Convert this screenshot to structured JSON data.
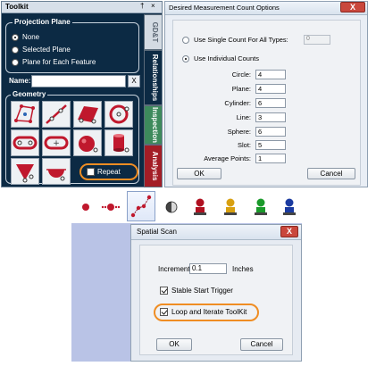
{
  "toolkit": {
    "title": "Toolkit",
    "pin": "†",
    "close": "×",
    "projection_plane": {
      "title": "Projection Plane",
      "options": [
        {
          "label": "None",
          "selected": true
        },
        {
          "label": "Selected Plane",
          "selected": false
        },
        {
          "label": "Plane for Each Feature",
          "selected": false
        }
      ]
    },
    "name_label": "Name:",
    "name_value": "",
    "name_clear": "X",
    "geometry": {
      "title": "Geometry",
      "tools": [
        "point-cloud-icon",
        "line-icon",
        "plane-icon",
        "circle-icon",
        "slot-icon",
        "round-slot-icon",
        "sphere-icon",
        "cylinder-icon",
        "cone-icon",
        "sphere-alt-icon"
      ]
    },
    "repeat_label": "Repeat",
    "repeat_checked": false,
    "tabs": [
      "GD&T",
      "Relationships",
      "Inspection",
      "Analysis"
    ],
    "colors": {
      "background": "#0c2a44",
      "highlight": "#ef8d23"
    }
  },
  "count_options": {
    "title": "Desired Measurement Count Options",
    "close": "X",
    "single_count_label": "Use Single Count For All Types:",
    "single_count_value": "0",
    "individual_counts_label": "Use Individual Counts",
    "individual_selected": true,
    "counts": [
      {
        "label": "Circle:",
        "value": "4"
      },
      {
        "label": "Plane:",
        "value": "4"
      },
      {
        "label": "Cylinder:",
        "value": "6"
      },
      {
        "label": "Line:",
        "value": "3"
      },
      {
        "label": "Sphere:",
        "value": "6"
      },
      {
        "label": "Slot:",
        "value": "5"
      },
      {
        "label": "Average Points:",
        "value": "1"
      }
    ],
    "ok_label": "OK",
    "cancel_label": "Cancel"
  },
  "toolbar": {
    "icons": [
      "red-dot-icon",
      "dotted-points-icon",
      "scan-path-icon",
      "sphere-probe-icon",
      "red-person-icon",
      "yellow-person-icon",
      "green-person-icon",
      "blue-person-icon"
    ],
    "selected_index": 2
  },
  "spatial_scan": {
    "title": "Spatial Scan",
    "close": "X",
    "increment_label": "Increment",
    "increment_value": "0.1",
    "increment_unit": "Inches",
    "stable_start_label": "Stable Start Trigger",
    "stable_start_checked": true,
    "loop_label": "Loop and Iterate ToolKit",
    "loop_checked": true,
    "ok_label": "OK",
    "cancel_label": "Cancel"
  }
}
